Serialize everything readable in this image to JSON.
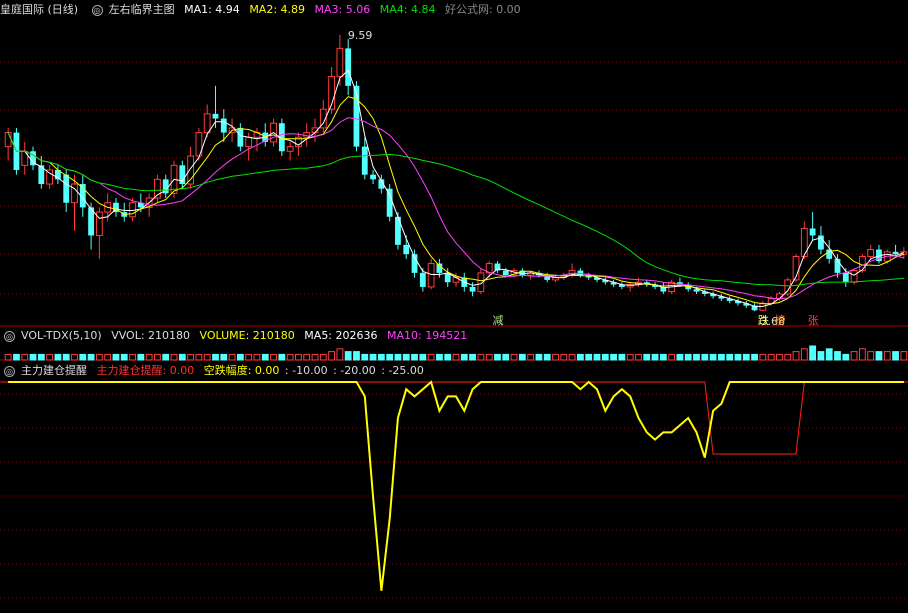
{
  "main_header": {
    "title": "皇庭国际 (日线)",
    "indicator_name": "左右临界主图",
    "ma1": "MA1: 4.94",
    "ma2": "MA2: 4.89",
    "ma3": "MA3: 5.06",
    "ma4": "MA4: 4.84",
    "source": "好公式网: 0.00"
  },
  "vol_header": {
    "name": "VOL-TDX(5,10)",
    "vvol": "VVOL: 210180",
    "volume": "VOLUME: 210180",
    "ma5": "MA5: 202636",
    "ma10": "MA10: 194521"
  },
  "ind_header": {
    "name": "主力建仓提醒",
    "signal": "主力建仓提醒: 0.00",
    "fall": "空跌幅度: 0.00",
    "l1": ": -10.00",
    "l2": ": -20.00",
    "l3": ": -25.00"
  },
  "colors": {
    "up": "#ff3c3c",
    "down": "#54ffff",
    "ma1": "#ffffff",
    "ma2": "#ffff00",
    "ma3": "#ff40ff",
    "ma4": "#00e000",
    "indicator": "#ffff00",
    "signal": "#ff2020",
    "grid": "#8b0000"
  },
  "chart_data": [
    {
      "type": "candlestick",
      "title": "皇庭国际 (日线)",
      "ylim": [
        3.45,
        9.95
      ],
      "annotations": [
        {
          "text": "9.59",
          "kind": "high"
        },
        {
          "text": "3.68",
          "kind": "low"
        },
        {
          "text": "减"
        },
        {
          "text": "跌"
        },
        {
          "text": "榜"
        },
        {
          "text": "张"
        }
      ],
      "ohlc": [
        [
          7.2,
          7.6,
          6.9,
          7.5
        ],
        [
          7.5,
          7.6,
          6.6,
          6.7
        ],
        [
          6.8,
          7.3,
          6.6,
          7.1
        ],
        [
          7.1,
          7.2,
          6.7,
          6.8
        ],
        [
          6.8,
          7.0,
          6.3,
          6.4
        ],
        [
          6.4,
          6.8,
          6.3,
          6.7
        ],
        [
          6.7,
          6.8,
          6.4,
          6.5
        ],
        [
          6.6,
          6.7,
          5.8,
          6.0
        ],
        [
          6.0,
          6.6,
          5.4,
          6.4
        ],
        [
          6.4,
          6.6,
          5.7,
          5.9
        ],
        [
          5.9,
          6.0,
          5.0,
          5.3
        ],
        [
          5.3,
          5.9,
          4.8,
          5.8
        ],
        [
          5.8,
          6.2,
          5.6,
          6.0
        ],
        [
          6.0,
          6.1,
          5.7,
          5.8
        ],
        [
          5.8,
          6.0,
          5.6,
          5.7
        ],
        [
          5.7,
          6.1,
          5.6,
          6.0
        ],
        [
          6.0,
          6.2,
          5.8,
          5.9
        ],
        [
          5.9,
          6.2,
          5.7,
          6.1
        ],
        [
          6.1,
          6.6,
          6.0,
          6.5
        ],
        [
          6.5,
          6.6,
          6.1,
          6.2
        ],
        [
          6.2,
          6.9,
          6.1,
          6.8
        ],
        [
          6.8,
          6.9,
          6.3,
          6.4
        ],
        [
          6.4,
          7.2,
          6.3,
          7.0
        ],
        [
          7.0,
          7.6,
          6.9,
          7.5
        ],
        [
          7.5,
          8.1,
          7.4,
          7.9
        ],
        [
          7.9,
          8.5,
          7.6,
          7.8
        ],
        [
          7.8,
          8.0,
          7.3,
          7.5
        ],
        [
          7.5,
          7.8,
          7.3,
          7.6
        ],
        [
          7.6,
          7.7,
          7.1,
          7.2
        ],
        [
          7.2,
          7.5,
          6.9,
          7.4
        ],
        [
          7.4,
          7.6,
          7.1,
          7.5
        ],
        [
          7.5,
          7.7,
          7.2,
          7.3
        ],
        [
          7.3,
          7.8,
          7.2,
          7.7
        ],
        [
          7.7,
          7.8,
          7.0,
          7.1
        ],
        [
          7.1,
          7.3,
          6.9,
          7.2
        ],
        [
          7.2,
          7.5,
          7.0,
          7.4
        ],
        [
          7.4,
          7.7,
          7.2,
          7.5
        ],
        [
          7.5,
          7.8,
          7.3,
          7.6
        ],
        [
          7.6,
          8.2,
          7.5,
          8.0
        ],
        [
          8.0,
          8.9,
          7.9,
          8.7
        ],
        [
          8.7,
          9.59,
          8.5,
          9.3
        ],
        [
          9.3,
          9.5,
          8.3,
          8.5
        ],
        [
          8.5,
          8.6,
          7.1,
          7.2
        ],
        [
          7.2,
          7.4,
          6.5,
          6.6
        ],
        [
          6.6,
          6.7,
          6.4,
          6.5
        ],
        [
          6.5,
          6.6,
          6.2,
          6.3
        ],
        [
          6.3,
          6.4,
          5.6,
          5.7
        ],
        [
          5.7,
          5.8,
          5.0,
          5.1
        ],
        [
          5.1,
          5.3,
          4.8,
          4.9
        ],
        [
          4.9,
          5.0,
          4.4,
          4.5
        ],
        [
          4.5,
          4.6,
          4.1,
          4.2
        ],
        [
          4.2,
          4.8,
          4.15,
          4.7
        ],
        [
          4.7,
          4.8,
          4.4,
          4.5
        ],
        [
          4.5,
          4.6,
          4.2,
          4.3
        ],
        [
          4.3,
          4.5,
          4.2,
          4.4
        ],
        [
          4.4,
          4.5,
          4.1,
          4.2
        ],
        [
          4.2,
          4.3,
          4.0,
          4.1
        ],
        [
          4.1,
          4.6,
          4.05,
          4.5
        ],
        [
          4.5,
          4.75,
          4.4,
          4.7
        ],
        [
          4.7,
          4.75,
          4.5,
          4.55
        ],
        [
          4.55,
          4.6,
          4.4,
          4.45
        ],
        [
          4.45,
          4.6,
          4.4,
          4.55
        ],
        [
          4.55,
          4.6,
          4.4,
          4.45
        ],
        [
          4.45,
          4.55,
          4.35,
          4.5
        ],
        [
          4.5,
          4.55,
          4.4,
          4.45
        ],
        [
          4.45,
          4.5,
          4.3,
          4.35
        ],
        [
          4.35,
          4.45,
          4.3,
          4.4
        ],
        [
          4.4,
          4.5,
          4.35,
          4.45
        ],
        [
          4.45,
          4.7,
          4.4,
          4.55
        ],
        [
          4.55,
          4.6,
          4.4,
          4.45
        ],
        [
          4.45,
          4.5,
          4.35,
          4.4
        ],
        [
          4.4,
          4.45,
          4.3,
          4.35
        ],
        [
          4.35,
          4.4,
          4.25,
          4.3
        ],
        [
          4.3,
          4.35,
          4.2,
          4.25
        ],
        [
          4.25,
          4.3,
          4.15,
          4.2
        ],
        [
          4.2,
          4.3,
          4.1,
          4.25
        ],
        [
          4.25,
          4.4,
          4.2,
          4.3
        ],
        [
          4.3,
          4.35,
          4.2,
          4.25
        ],
        [
          4.25,
          4.3,
          4.15,
          4.2
        ],
        [
          4.2,
          4.3,
          4.05,
          4.1
        ],
        [
          4.1,
          4.35,
          4.05,
          4.3
        ],
        [
          4.3,
          4.4,
          4.2,
          4.25
        ],
        [
          4.25,
          4.3,
          4.1,
          4.15
        ],
        [
          4.15,
          4.2,
          4.05,
          4.1
        ],
        [
          4.1,
          4.15,
          4.0,
          4.05
        ],
        [
          4.05,
          4.1,
          3.95,
          4.0
        ],
        [
          4.0,
          4.05,
          3.9,
          3.95
        ],
        [
          3.95,
          4.0,
          3.85,
          3.9
        ],
        [
          3.9,
          3.95,
          3.8,
          3.85
        ],
        [
          3.85,
          3.9,
          3.75,
          3.8
        ],
        [
          3.8,
          3.85,
          3.68,
          3.7
        ],
        [
          3.7,
          3.9,
          3.68,
          3.85
        ],
        [
          3.85,
          4.0,
          3.8,
          3.95
        ],
        [
          3.95,
          4.1,
          3.9,
          4.05
        ],
        [
          4.05,
          4.4,
          4.0,
          4.35
        ],
        [
          4.35,
          4.9,
          4.3,
          4.85
        ],
        [
          4.85,
          5.6,
          4.8,
          5.45
        ],
        [
          5.45,
          5.8,
          5.2,
          5.3
        ],
        [
          5.3,
          5.5,
          4.9,
          5.0
        ],
        [
          5.0,
          5.2,
          4.7,
          4.8
        ],
        [
          4.8,
          4.9,
          4.4,
          4.5
        ],
        [
          4.5,
          4.6,
          4.2,
          4.3
        ],
        [
          4.3,
          4.6,
          4.25,
          4.55
        ],
        [
          4.55,
          4.9,
          4.5,
          4.85
        ],
        [
          4.85,
          5.1,
          4.8,
          5.0
        ],
        [
          5.0,
          5.1,
          4.7,
          4.75
        ],
        [
          4.75,
          5.0,
          4.7,
          4.95
        ],
        [
          4.95,
          5.1,
          4.85,
          4.9
        ],
        [
          4.9,
          5.05,
          4.8,
          4.95
        ]
      ]
    },
    {
      "type": "bar",
      "title": "VOL-TDX(5,10)",
      "series": [
        {
          "name": "VOLUME",
          "values": [
            2,
            2,
            2,
            2,
            2,
            2,
            2,
            2,
            2,
            2,
            2,
            2,
            2,
            2,
            2,
            2,
            2,
            2,
            2,
            2,
            2,
            2,
            2,
            2,
            2,
            2,
            2,
            2,
            2,
            2,
            2,
            2,
            2,
            2,
            2,
            2,
            2,
            2,
            2,
            3,
            4,
            3,
            3,
            2,
            2,
            2,
            2,
            2,
            2,
            2,
            2,
            2,
            2,
            2,
            2,
            2,
            2,
            2,
            2,
            2,
            2,
            2,
            2,
            2,
            2,
            2,
            2,
            2,
            2,
            2,
            2,
            2,
            2,
            2,
            2,
            2,
            2,
            2,
            2,
            2,
            2,
            2,
            2,
            2,
            2,
            2,
            2,
            2,
            2,
            2,
            2,
            2,
            2,
            2,
            2,
            3,
            4,
            5,
            3,
            4,
            3,
            2,
            3,
            4,
            3,
            3,
            3,
            3,
            3
          ]
        }
      ]
    },
    {
      "type": "line",
      "title": "主力建仓提醒",
      "ylim": [
        -30,
        0
      ],
      "series": [
        {
          "name": "主力建仓提醒",
          "values": [
            0,
            0,
            0,
            0,
            0,
            0,
            0,
            0,
            0,
            0,
            0,
            0,
            0,
            0,
            0,
            0,
            0,
            0,
            0,
            0,
            0,
            0,
            0,
            0,
            0,
            0,
            0,
            0,
            0,
            0,
            0,
            0,
            0,
            0,
            0,
            0,
            0,
            0,
            0,
            0,
            0,
            0,
            0,
            0,
            0,
            0,
            0,
            0,
            0,
            0,
            0,
            0,
            0,
            0,
            0,
            0,
            0,
            0,
            0,
            0,
            0,
            0,
            0,
            0,
            0,
            0,
            0,
            0,
            0,
            0,
            0,
            0,
            0,
            0,
            0,
            0,
            0,
            0,
            0,
            0,
            0,
            0,
            0,
            0,
            0,
            -10,
            -10,
            -10,
            -10,
            -10,
            -10,
            -10,
            -10,
            -10,
            -10,
            -10,
            0,
            0,
            0,
            0,
            0,
            0,
            0,
            0,
            0,
            0,
            0,
            0,
            0,
            0
          ]
        },
        {
          "name": "空跌幅度",
          "values": [
            0,
            0,
            0,
            0,
            0,
            0,
            0,
            0,
            0,
            0,
            0,
            0,
            0,
            0,
            0,
            0,
            0,
            0,
            0,
            0,
            0,
            0,
            0,
            0,
            0,
            0,
            0,
            0,
            0,
            0,
            0,
            0,
            0,
            0,
            0,
            0,
            0,
            0,
            0,
            0,
            0,
            0,
            0,
            -2,
            -16,
            -29,
            -19,
            -5,
            -1,
            -2,
            -1,
            0,
            -4,
            -2,
            -2,
            -4,
            -1,
            0,
            0,
            0,
            0,
            0,
            0,
            0,
            0,
            0,
            0,
            0,
            0,
            -1,
            0,
            -1,
            -4,
            -2,
            -1,
            -2,
            -5,
            -7,
            -8,
            -7,
            -7,
            -6,
            -5,
            -7,
            -10.5,
            -4,
            -3,
            0,
            0,
            0,
            0,
            0,
            0,
            0,
            0,
            0,
            0,
            0,
            0,
            0,
            0,
            0,
            0,
            0,
            0,
            0,
            0,
            0,
            0
          ]
        }
      ]
    }
  ]
}
